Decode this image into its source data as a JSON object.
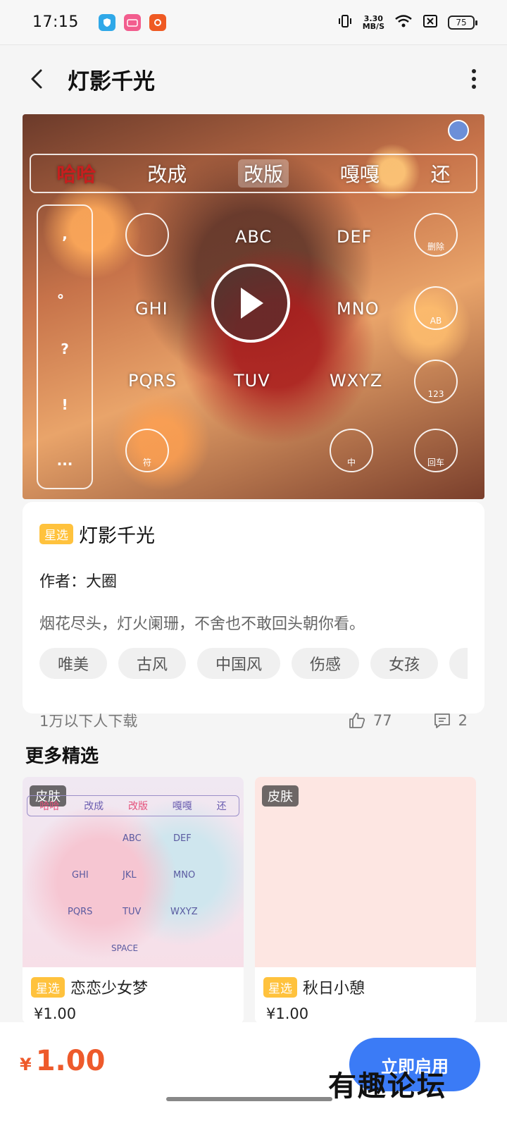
{
  "status_bar": {
    "time": "17:15",
    "net_speed_value": "3.30",
    "net_speed_unit": "MB/S",
    "battery": "75",
    "apps": [
      {
        "name": "shield-app",
        "color": "#2fa8e8"
      },
      {
        "name": "bilibili-app",
        "color": "#f25d8e"
      },
      {
        "name": "orange-app",
        "color": "#ef5a23"
      }
    ]
  },
  "header": {
    "title": "灯影千光"
  },
  "preview": {
    "candidates": [
      "哈哈",
      "改成",
      "改版",
      "嘎嘎",
      "还"
    ],
    "side_keys": [
      ",",
      "。",
      "?",
      "!",
      "..."
    ],
    "keys": [
      "ABC",
      "DEF",
      "GHI",
      "MNO",
      "PQRS",
      "TUV",
      "WXYZ"
    ],
    "function_keys": [
      "删除",
      "AB",
      "123",
      "回车",
      "中",
      "符"
    ]
  },
  "info": {
    "badge": "星选",
    "title": "灯影千光",
    "author": "作者：大圈",
    "description": "烟花尽头，灯火阑珊，不舍也不敢回头朝你看。",
    "tags": [
      "唯美",
      "古风",
      "中国风",
      "伤感",
      "女孩",
      ""
    ],
    "downloads": "1万以下人下载",
    "likes": "77",
    "comments": "2"
  },
  "more_section": {
    "title": "更多精选",
    "cards": [
      {
        "label": "皮肤",
        "badge": "星选",
        "title": "恋恋少女梦",
        "price": "¥1.00",
        "preview_keys": [
          "哈哈",
          "改成",
          "改版",
          "嘎嘎",
          "还",
          "ABC",
          "DEF",
          "GHI",
          "JKL",
          "MNO",
          "PQRS",
          "TUV",
          "WXYZ",
          "SPACE"
        ]
      },
      {
        "label": "皮肤",
        "badge": "星选",
        "title": "秋日小憩",
        "price": "¥1.00"
      }
    ]
  },
  "bottom_bar": {
    "currency": "¥",
    "price": "1.00",
    "apply_label": "立即启用",
    "watermark": "有趣论坛"
  },
  "colors": {
    "accent_blue": "#3b7bf6",
    "price_orange": "#ee5a2b",
    "badge_yellow": "#ffc23d"
  }
}
